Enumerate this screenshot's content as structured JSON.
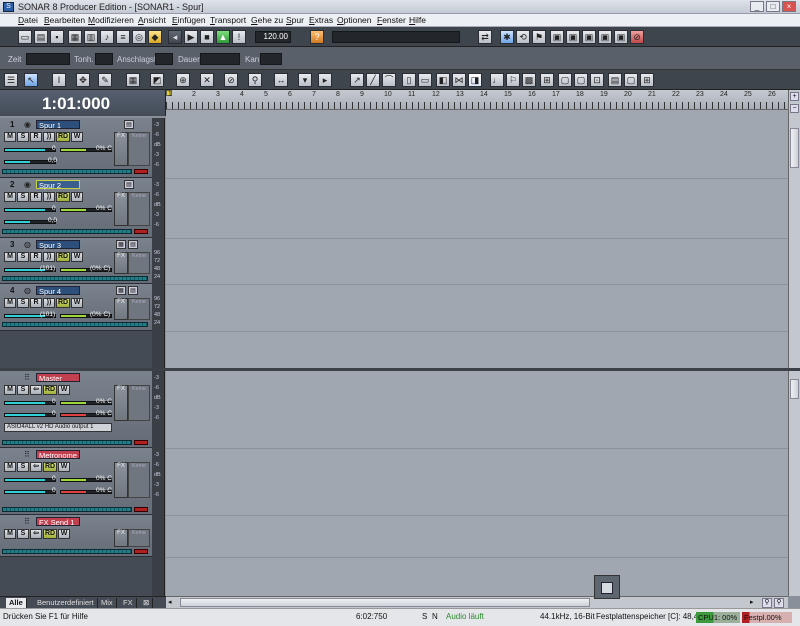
{
  "window": {
    "title": "SONAR 8 Producer Edition - [SONAR1 - Spur]",
    "min": "_",
    "max": "□",
    "close": "×"
  },
  "menu": [
    "Datei",
    "Bearbeiten",
    "Modifizieren",
    "Ansicht",
    "Einfügen",
    "Transport",
    "Gehe zu",
    "Spur",
    "Extras",
    "Optionen",
    "Fenster",
    "Hilfe"
  ],
  "transport": {
    "tempo": "120.00"
  },
  "event_bar": {
    "zeit": "Zeit",
    "tonh": "Tonh.",
    "anschlag": "Anschlagst.",
    "dauer": "Dauer",
    "kan": "Kan"
  },
  "time_display": "1:01:000",
  "ruler": {
    "marks": [
      "1",
      "2",
      "3",
      "4",
      "5",
      "6",
      "7",
      "8",
      "9",
      "10",
      "11",
      "12",
      "13",
      "14",
      "15",
      "16",
      "17",
      "18",
      "19",
      "20",
      "21",
      "22",
      "23",
      "24",
      "25",
      "26"
    ]
  },
  "tracks": [
    {
      "num": "1",
      "name": "Spur 1",
      "vol": "0",
      "pan": "0% C",
      "vel": "0,0",
      "m": "M",
      "s": "S",
      "r": "R",
      "rd": "RD",
      "w": "W",
      "fx": "FX"
    },
    {
      "num": "2",
      "name": "Spur 2",
      "vol": "0",
      "pan": "0% C",
      "vel": "0,0",
      "m": "M",
      "s": "S",
      "r": "R",
      "rd": "RD",
      "w": "W",
      "fx": "FX"
    },
    {
      "num": "3",
      "name": "Spur 3",
      "vol": "(101)",
      "pan": "(0% C)",
      "m": "M",
      "s": "S",
      "r": "R",
      "rd": "RD",
      "w": "W",
      "fx": "FX"
    },
    {
      "num": "4",
      "name": "Spur 4",
      "vol": "(101)",
      "pan": "(0% C)",
      "m": "M",
      "s": "S",
      "r": "R",
      "rd": "RD",
      "w": "W",
      "fx": "FX"
    }
  ],
  "buses": [
    {
      "name": "Master",
      "vol1": "0",
      "pan1": "0% C",
      "vol2": "0",
      "pan2": "0% C",
      "output": "ASIO4ALL v2 HD Audio output 1",
      "m": "M",
      "s": "S",
      "rd": "RD",
      "w": "W",
      "fx": "FX"
    },
    {
      "name": "Metronome",
      "vol1": "0",
      "pan1": "0% C",
      "vol2": "0",
      "pan2": "0% C",
      "m": "M",
      "s": "S",
      "rd": "RD",
      "w": "W",
      "fx": "FX"
    },
    {
      "name": "FX Send 1",
      "m": "M",
      "s": "S",
      "rd": "RD",
      "w": "W",
      "fx": "FX"
    }
  ],
  "meter_scale_audio": [
    "-3",
    "-6",
    "dB",
    "-3",
    "-6"
  ],
  "meter_scale_midi": [
    "96",
    "72",
    "48",
    "24"
  ],
  "tabs": [
    "Alle",
    "Benutzerdefiniert",
    "Mix",
    "FX"
  ],
  "status": {
    "help": "Drücken Sie F1 für Hilfe",
    "time": "6:02:750",
    "s": "S",
    "n": "N",
    "audio": "Audio läuft",
    "format": "44.1kHz, 16-Bit",
    "disk": "Festplattenspeicher [C]: 48,4G",
    "cpu": "CPU1: 00%",
    "disk_load": "Festpl.00%"
  },
  "colors": {
    "track_name": "#2d4f7c",
    "bus_name": "#c04050",
    "fader": "#2fd0d8",
    "audio_running": "#2a8a2a"
  }
}
